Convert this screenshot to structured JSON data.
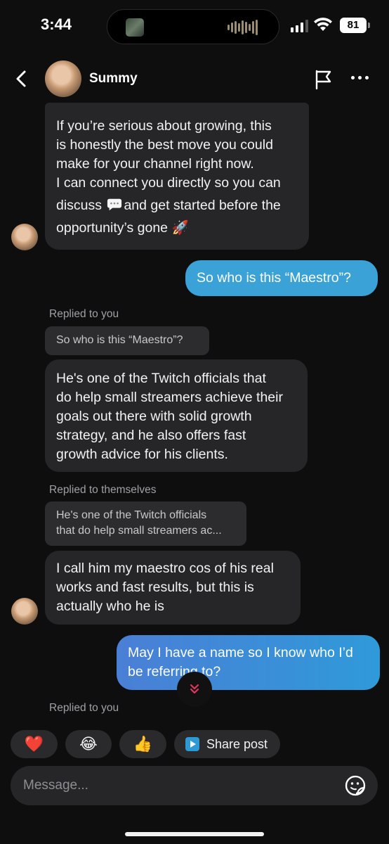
{
  "status_bar": {
    "time": "3:44",
    "battery": "81"
  },
  "header": {
    "name": "Summy"
  },
  "messages": {
    "m1": {
      "line1": "If you’re serious about growing, this",
      "line2": "is honestly the best move you could",
      "line3": "make for your channel right now.",
      "line4": "I can connect you directly so you can",
      "line5a": "discuss",
      "line5b": "and get started before the",
      "line6": "opportunity’s gone",
      "rocket": "🚀"
    },
    "m2": {
      "text": "So who is this “Maestro”?"
    },
    "m3": {
      "reply_label": "Replied to you",
      "quote": "So who is this “Maestro”?",
      "line1": "He's one of the Twitch officials that",
      "line2": "do help small streamers achieve their",
      "line3": "goals out there with solid growth",
      "line4": "strategy, and he also offers fast",
      "line5": "growth advice for his clients."
    },
    "m4": {
      "reply_label": "Replied to themselves",
      "quote_line1": "He's one of the Twitch officials",
      "quote_line2": "that do help small streamers ac...",
      "line1": "I call him my maestro cos of his real",
      "line2": "works and fast results, but this is",
      "line3": "actually who he is"
    },
    "m5": {
      "line1": "May I have a name so I know who I’d",
      "line2": "be referring to?"
    },
    "m6": {
      "reply_label": "Replied to you"
    }
  },
  "quick_reactions": {
    "heart": "❤️",
    "laugh": "😂",
    "thumbs_up": "👍",
    "share_post": "Share post"
  },
  "composer": {
    "placeholder": "Message..."
  },
  "colors": {
    "background": "#0e0e0f",
    "incoming_bubble": "#262628",
    "outgoing_bubble_light": "#3aa2d6",
    "outgoing_bubble_gradient_start": "#4a7fd6",
    "outgoing_bubble_gradient_end": "#2f9ad9"
  }
}
